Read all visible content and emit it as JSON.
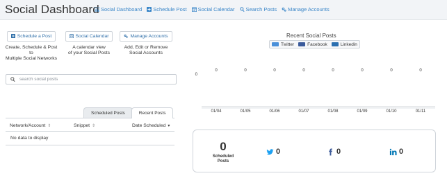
{
  "app": {
    "title": "Social Dashboard"
  },
  "nav": [
    {
      "label": "Social Dashboard",
      "icon": "bar-chart-icon"
    },
    {
      "label": "Schedule Post",
      "icon": "plus-square-icon"
    },
    {
      "label": "Social Calendar",
      "icon": "calendar-icon"
    },
    {
      "label": "Search Posts",
      "icon": "search-icon"
    },
    {
      "label": "Manage Accounts",
      "icon": "gears-icon"
    }
  ],
  "actions": [
    {
      "label": "Schedule a Post",
      "icon": "plus-square-icon",
      "desc1": "Create, Schedule & Post to",
      "desc2": "Multiple Social Networks"
    },
    {
      "label": "Social Calendar",
      "icon": "calendar-icon",
      "desc1": "A calendar view",
      "desc2": "of your Social Posts"
    },
    {
      "label": "Manage Accounts",
      "icon": "gears-icon",
      "desc1": "Add, Edit or Remove",
      "desc2": "Social Accounts"
    }
  ],
  "search": {
    "placeholder": "search social posts",
    "value": ""
  },
  "tabs": [
    {
      "label": "Scheduled Posts",
      "active": false
    },
    {
      "label": "Recent Posts",
      "active": true
    }
  ],
  "table": {
    "columns": [
      {
        "label": "Network/Account",
        "sort": "⇕"
      },
      {
        "label": "Snippet",
        "sort": "⇕"
      },
      {
        "label": "Date Scheduled",
        "sort": "▾"
      }
    ],
    "empty_text": "No data to display"
  },
  "chart_data": {
    "type": "bar",
    "title": "Recent Social Posts",
    "categories": [
      "01/04",
      "01/05",
      "01/06",
      "01/07",
      "01/08",
      "01/09",
      "01/10",
      "01/11"
    ],
    "series": [
      {
        "name": "Twitter",
        "values": [
          0,
          0,
          0,
          0,
          0,
          0,
          0,
          0
        ],
        "color": "#4a90d9"
      },
      {
        "name": "Facebook",
        "values": [
          0,
          0,
          0,
          0,
          0,
          0,
          0,
          0
        ],
        "color": "#3b5b9b"
      },
      {
        "name": "Linkedin",
        "values": [
          0,
          0,
          0,
          0,
          0,
          0,
          0,
          0
        ],
        "color": "#2a6fb0"
      }
    ],
    "y_tick_labels": [
      "0"
    ],
    "ylim": [
      0,
      1
    ],
    "legend_position": "top-center",
    "grid": false
  },
  "stats": {
    "scheduled_count": "0",
    "scheduled_label1": "Scheduled",
    "scheduled_label2": "Posts",
    "twitter_count": "0",
    "facebook_count": "0",
    "linkedin_count": "0"
  },
  "colors": {
    "accent": "#3a86c8",
    "twitter": "#1da1f2",
    "facebook": "#3b5998",
    "linkedin": "#0077b5"
  }
}
